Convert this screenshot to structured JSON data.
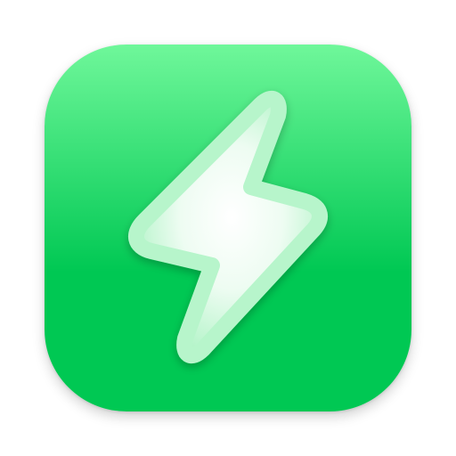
{
  "app_icon": {
    "icon": "lightning-bolt-icon",
    "colors": {
      "background_top": "#6ff79a",
      "background_bottom": "#00c853",
      "bolt_center": "#ffffff",
      "bolt_edge": "#a6f2bf"
    }
  }
}
